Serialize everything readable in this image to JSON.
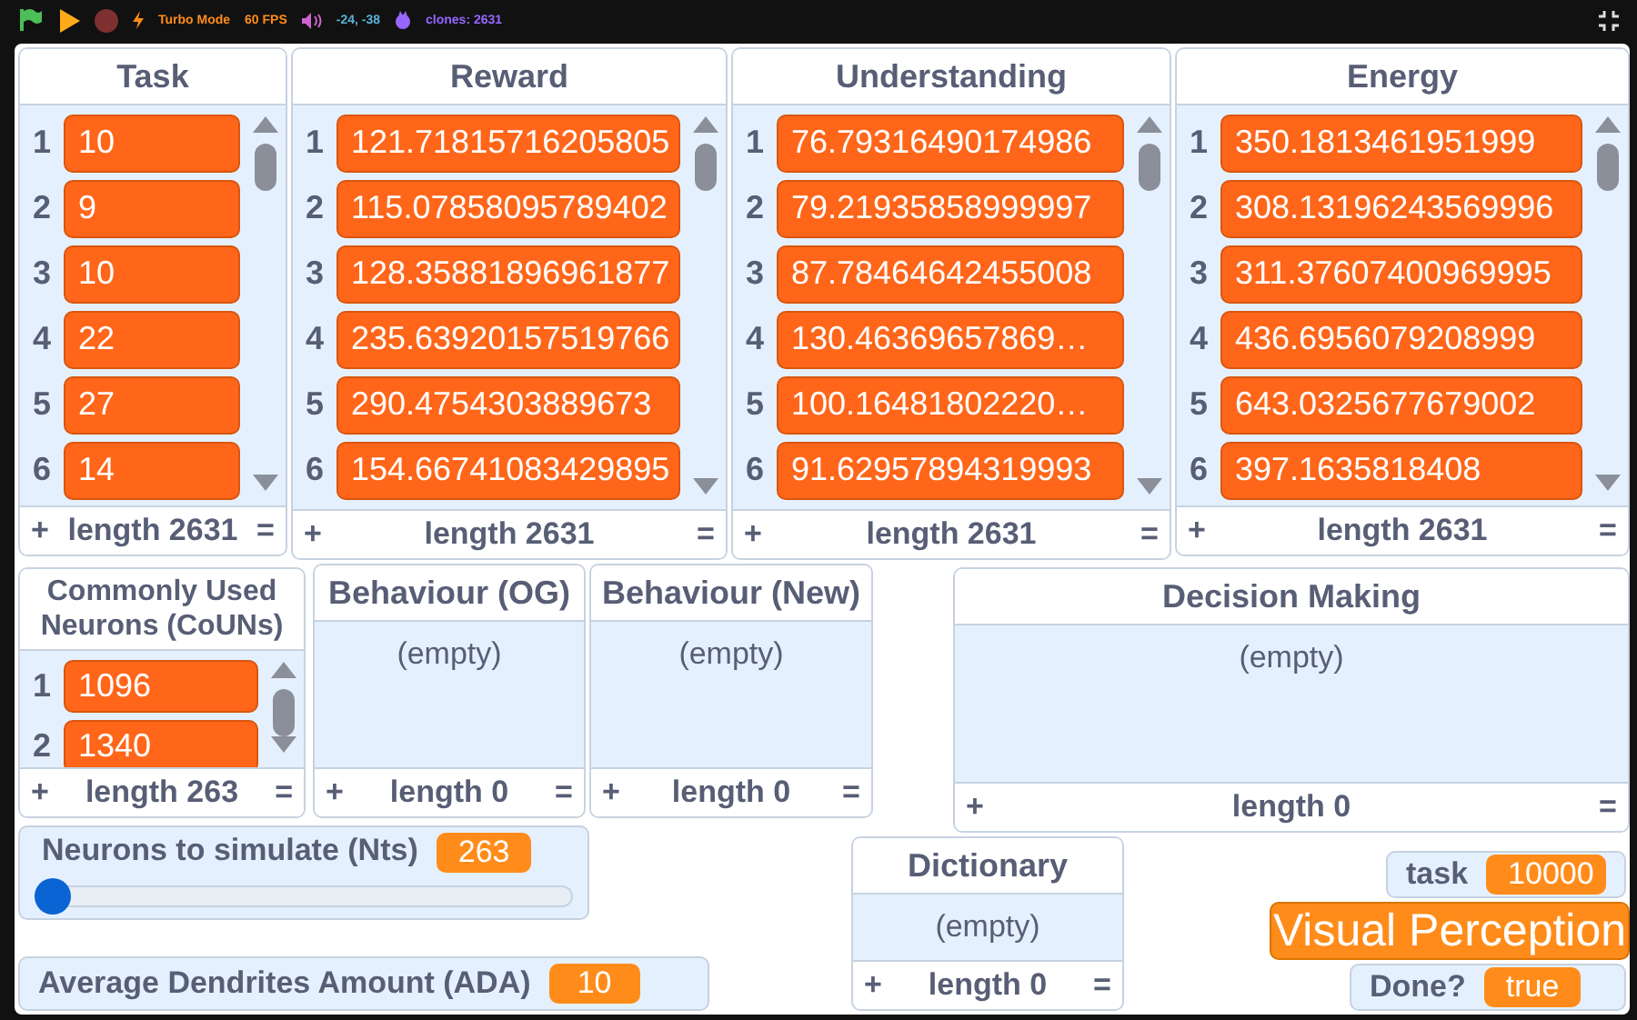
{
  "toolbar": {
    "turbo_label": "Turbo Mode",
    "fps": "60 FPS",
    "coordinates": "-24, -38",
    "clones": "clones: 2631"
  },
  "lists": [
    {
      "title": "Task",
      "items": [
        {
          "index": "1",
          "value": "10"
        },
        {
          "index": "2",
          "value": "9"
        },
        {
          "index": "3",
          "value": "10"
        },
        {
          "index": "4",
          "value": "22"
        },
        {
          "index": "5",
          "value": "27"
        },
        {
          "index": "6",
          "value": "14"
        }
      ],
      "length_label": "length 2631",
      "add": "+",
      "resize": "="
    },
    {
      "title": "Reward",
      "items": [
        {
          "index": "1",
          "value": "121.71815716205805"
        },
        {
          "index": "2",
          "value": "115.07858095789402"
        },
        {
          "index": "3",
          "value": "128.35881896961877"
        },
        {
          "index": "4",
          "value": "235.63920157519766"
        },
        {
          "index": "5",
          "value": "290.4754303889673"
        },
        {
          "index": "6",
          "value": "154.66741083429895"
        }
      ],
      "length_label": "length 2631",
      "add": "+",
      "resize": "="
    },
    {
      "title": "Understanding",
      "items": [
        {
          "index": "1",
          "value": "76.79316490174986"
        },
        {
          "index": "2",
          "value": "79.21935858999997"
        },
        {
          "index": "3",
          "value": "87.78464642455008"
        },
        {
          "index": "4",
          "value": "130.46369657869…"
        },
        {
          "index": "5",
          "value": "100.16481802220…"
        },
        {
          "index": "6",
          "value": "91.62957894319993"
        }
      ],
      "length_label": "length 2631",
      "add": "+",
      "resize": "="
    },
    {
      "title": "Energy",
      "items": [
        {
          "index": "1",
          "value": "350.1813461951999"
        },
        {
          "index": "2",
          "value": "308.13196243569996"
        },
        {
          "index": "3",
          "value": "311.37607400969995"
        },
        {
          "index": "4",
          "value": "436.6956079208999"
        },
        {
          "index": "5",
          "value": "643.0325677679002"
        },
        {
          "index": "6",
          "value": "397.1635818408"
        }
      ],
      "length_label": "length 2631",
      "add": "+",
      "resize": "="
    },
    {
      "title": "Commonly Used Neurons (CoUNs)",
      "items": [
        {
          "index": "1",
          "value": "1096"
        },
        {
          "index": "2",
          "value": "1340"
        }
      ],
      "length_label": "length 263",
      "add": "+",
      "resize": "="
    },
    {
      "title": "Behaviour (OG)",
      "empty_text": "(empty)",
      "length_label": "length 0",
      "add": "+",
      "resize": "="
    },
    {
      "title": "Behaviour (New)",
      "empty_text": "(empty)",
      "length_label": "length 0",
      "add": "+",
      "resize": "="
    },
    {
      "title": "Decision Making",
      "empty_text": "(empty)",
      "length_label": "length 0",
      "add": "+",
      "resize": "="
    },
    {
      "title": "Dictionary",
      "empty_text": "(empty)",
      "length_label": "length 0",
      "add": "+",
      "resize": "="
    }
  ],
  "monitors": [
    {
      "kind": "slider",
      "label": "Neurons to simulate (Nts)",
      "value": "263",
      "level": 0
    },
    {
      "kind": "normal",
      "label": "Average Dendrites Amount (ADA)",
      "value": "10"
    },
    {
      "kind": "normal",
      "label": "task",
      "value": "10000"
    },
    {
      "kind": "large",
      "value": "Visual Perception"
    },
    {
      "kind": "normal",
      "label": "Done?",
      "value": "true"
    }
  ]
}
